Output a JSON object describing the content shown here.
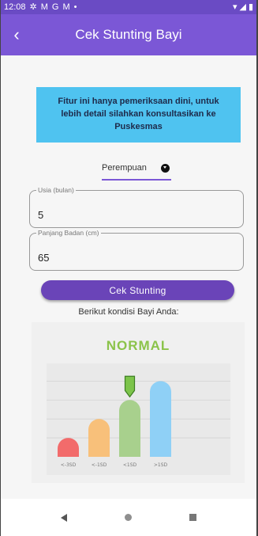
{
  "status_bar": {
    "time": "12:08",
    "icons_left": [
      "gear-icon",
      "gmail-icon",
      "google-icon",
      "gmail-icon",
      "dot-icon"
    ],
    "icons_right": [
      "wifi-icon",
      "signal-icon",
      "battery-icon"
    ]
  },
  "app_bar": {
    "back_glyph": "‹",
    "title": "Cek Stunting Bayi"
  },
  "notice": {
    "text": "Fitur ini hanya pemeriksaan dini, untuk lebih detail silahkan konsultasikan ke Puskesmas",
    "background": "#4fc3f0"
  },
  "gender_select": {
    "value": "Perempuan"
  },
  "age_field": {
    "label": "Usia (bulan)",
    "value": "5"
  },
  "length_field": {
    "label": "Panjang Badan (cm)",
    "value": "65"
  },
  "submit_button": {
    "label": "Cek Stunting",
    "color": "#6a44b8"
  },
  "result": {
    "caption": "Berikut kondisi Bayi Anda:",
    "status": "NORMAL",
    "status_color": "#8bc34a"
  },
  "chart_data": {
    "type": "bar",
    "categories": [
      "<-3SD",
      "<-1SD",
      "<1SD",
      ">1SD"
    ],
    "values": [
      1,
      2,
      3,
      4
    ],
    "colors": [
      "#f26b6b",
      "#f8c07a",
      "#a8d08d",
      "#8fd0f6"
    ],
    "highlight_index": 2,
    "marker_color": "#7cc44a",
    "grid": true,
    "ylim": [
      0,
      4.6
    ]
  },
  "nav_bar": {
    "icons": [
      "back-nav-icon",
      "home-nav-icon",
      "recents-nav-icon"
    ]
  }
}
